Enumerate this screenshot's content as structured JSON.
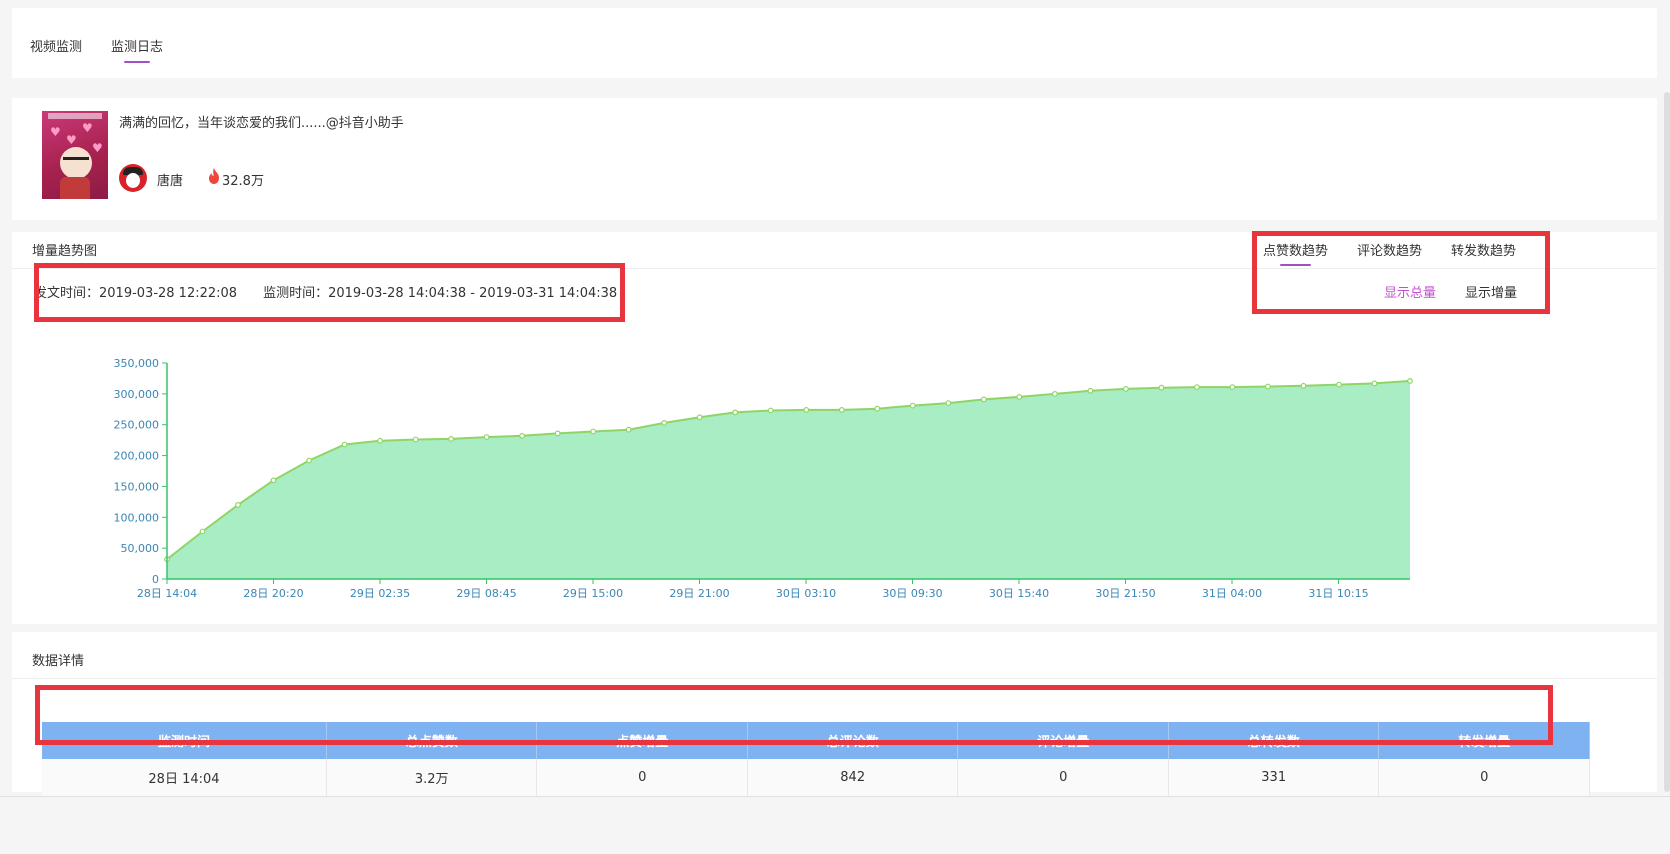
{
  "tabs": {
    "items": [
      {
        "label": "视频监测",
        "active": false
      },
      {
        "label": "监测日志",
        "active": true
      }
    ]
  },
  "video": {
    "title": "满满的回忆，当年谈恋爱的我们......@抖音小助手",
    "author": "唐唐",
    "fans": "32.8万"
  },
  "trend": {
    "title": "增量趋势图",
    "publish_time": "发文时间：2019-03-28 12:22:08",
    "monitor_time": "监测时间：2019-03-28 14:04:38 - 2019-03-31 14:04:38",
    "tabs": [
      "点赞数趋势",
      "评论数趋势",
      "转发数趋势"
    ],
    "active_tab": "点赞数趋势",
    "modes": {
      "total": "显示总量",
      "increment": "显示增量"
    },
    "active_mode": "显示总量"
  },
  "chart_data": {
    "type": "area",
    "title": "",
    "xlabel": "",
    "ylabel": "",
    "ylim": [
      0,
      350000
    ],
    "yticks": [
      0,
      50000,
      100000,
      150000,
      200000,
      250000,
      300000,
      350000
    ],
    "ytick_labels": [
      "0",
      "50,000",
      "100,000",
      "150,000",
      "200,000",
      "250,000",
      "300,000",
      "350,000"
    ],
    "xtick_labels": [
      "28日 14:04",
      "28日 20:20",
      "29日 02:35",
      "29日 08:45",
      "29日 15:00",
      "29日 21:00",
      "30日 03:10",
      "30日 09:30",
      "30日 15:40",
      "30日 21:50",
      "31日 04:00",
      "31日 10:15"
    ],
    "values": [
      32000,
      77000,
      120000,
      160000,
      192000,
      218000,
      224000,
      226000,
      227000,
      230000,
      232000,
      236000,
      239000,
      242000,
      253000,
      262000,
      270000,
      273000,
      274000,
      274000,
      276000,
      281000,
      285000,
      291000,
      295000,
      300000,
      305000,
      308000,
      310000,
      311000,
      311000,
      312000,
      313000,
      315000,
      317000,
      321000
    ],
    "colors": {
      "line": "#8fd566",
      "fill": "#a8edc4",
      "axis": "#36c36a",
      "tick_text": "#3a86b4"
    },
    "grid": false,
    "legend": "none"
  },
  "details": {
    "title": "数据详情",
    "columns": [
      "监测时间",
      "总点赞数",
      "点赞增量",
      "总评论数",
      "评论增量",
      "总转发数",
      "转发增量"
    ],
    "rows": [
      [
        "28日 14:04",
        "3.2万",
        "0",
        "842",
        "0",
        "331",
        "0"
      ]
    ]
  },
  "colors": {
    "accent": "#a34fc8",
    "active_mode": "#c44fd0",
    "table_header": "#7fb2f0",
    "highlight_box": "#e8343c"
  }
}
